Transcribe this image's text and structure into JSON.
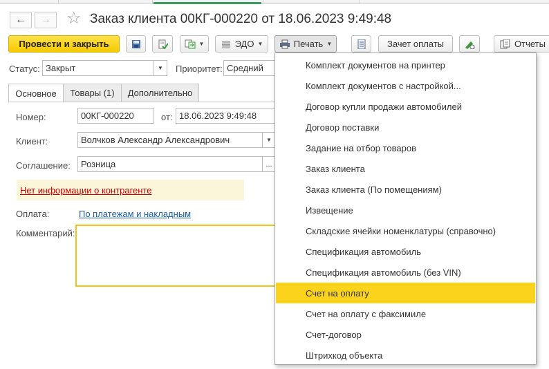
{
  "window": {
    "title": "Заказ клиента 00КГ-000220 от 18.06.2023 9:49:48"
  },
  "nav": {
    "back_icon": "←",
    "forward_icon": "→",
    "star_icon": "☆"
  },
  "toolbar": {
    "post_close_label": "Провести и закрыть",
    "edo_label": "ЭДО",
    "print_label": "Печать",
    "offset_label": "Зачет оплаты",
    "reports_label": "Отчеты"
  },
  "status": {
    "status_label": "Статус:",
    "status_value": "Закрыт",
    "priority_label": "Приоритет:",
    "priority_value": "Средний"
  },
  "tabs": [
    {
      "label": "Основное",
      "active": true
    },
    {
      "label": "Товары (1)",
      "active": false
    },
    {
      "label": "Дополнительно",
      "active": false
    }
  ],
  "form": {
    "number_label": "Номер:",
    "number_value": "00КГ-000220",
    "date_label": "от:",
    "date_value": "18.06.2023  9:49:48",
    "client_label": "Клиент:",
    "client_value": "Волчков Александр Александрович",
    "agreement_label": "Соглашение:",
    "agreement_value": "Розница",
    "agreement_btn": "...",
    "warning_link": "Нет информации о контрагенте",
    "payment_label": "Оплата:",
    "payment_link": "По платежам и накладным",
    "comment_label": "Комментарий:",
    "comment_value": ""
  },
  "print_menu": {
    "items": [
      "Комплект документов на принтер",
      "Комплект документов с настройкой...",
      "Договор купли продажи автомобилей",
      "Договор поставки",
      "Задание на отбор товаров",
      "Заказ клиента",
      "Заказ клиента (По помещениям)",
      "Извещение",
      "Складские ячейки номенклатуры (справочно)",
      "Спецификация автомобиль",
      "Спецификация автомобиль (без VIN)",
      "Счет на оплату",
      "Счет на оплату с факсимиле",
      "Счет-договор",
      "Штрихкод объекта"
    ],
    "selected": "Счет на оплату"
  },
  "colors": {
    "primary_button": "#f6c900",
    "menu_highlight": "#fbd31c",
    "warning_link": "#d00000",
    "link": "#1a5ea8",
    "comment_border": "#f1c40f"
  }
}
